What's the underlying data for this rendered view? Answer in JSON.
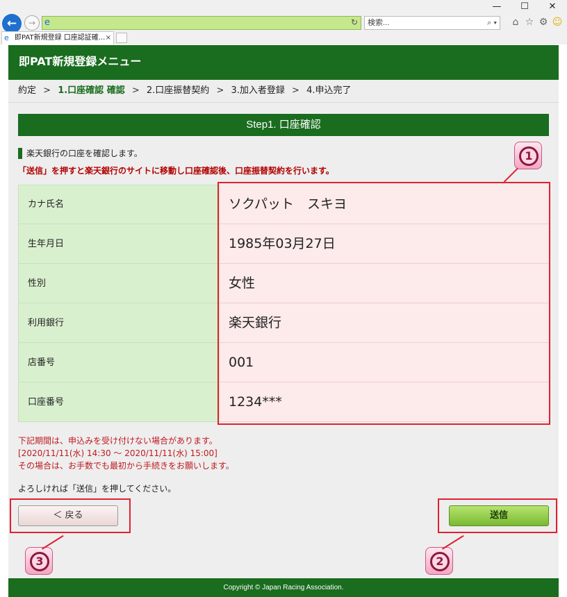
{
  "browser": {
    "tab_title": "即PAT新規登録 口座認証確...",
    "tab_close": "×",
    "search_placeholder": "検索...",
    "window_controls": [
      "—",
      "☐",
      "✕"
    ]
  },
  "header": {
    "title": "即PAT新規登録メニュー"
  },
  "steps": {
    "items": [
      {
        "label": "約定",
        "active": false
      },
      {
        "label": "1.口座確認 確認",
        "active": true
      },
      {
        "label": "2.口座振替契約",
        "active": false
      },
      {
        "label": "3.加入者登録",
        "active": false
      },
      {
        "label": "4.申込完了",
        "active": false
      }
    ],
    "separator": ">"
  },
  "step_title": "Step1. 口座確認",
  "intro": "楽天銀行の口座を確認します。",
  "notice": "「送信」を押すと楽天銀行のサイトに移動し口座確認後、口座振替契約を行います。",
  "account": {
    "rows": [
      {
        "label": "カナ氏名",
        "value": "ソクパット　スキヨ"
      },
      {
        "label": "生年月日",
        "value": "1985年03月27日"
      },
      {
        "label": "性別",
        "value": "女性"
      },
      {
        "label": "利用銀行",
        "value": "楽天銀行"
      },
      {
        "label": "店番号",
        "value": "001"
      },
      {
        "label": "口座番号",
        "value": "1234***"
      }
    ]
  },
  "warning": {
    "line1": "下記期間は、申込みを受け付けない場合があります。",
    "line2": "[2020/11/11(水) 14:30 ～ 2020/11/11(水) 15:00]",
    "line3": "その場合は、お手数でも最初から手続きをお願いします。"
  },
  "confirm_text": "よろしければ「送信」を押してください。",
  "buttons": {
    "back": "＜ 戻る",
    "send": "送信"
  },
  "callouts": {
    "one": "1",
    "two": "2",
    "three": "3"
  },
  "footer": "Copyright © Japan Racing Association.",
  "colors": {
    "brand_green": "#1a6c1f",
    "highlight_red": "#e02030",
    "warning_red": "#c0191f"
  }
}
